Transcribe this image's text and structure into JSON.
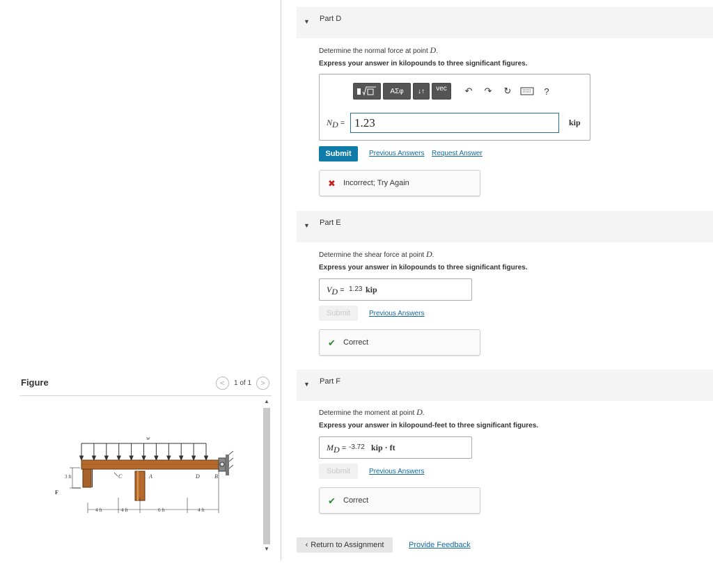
{
  "figure": {
    "title": "Figure",
    "pager": "1 of 1",
    "labels": {
      "w": "w",
      "c": "C",
      "a": "A",
      "d": "D",
      "b": "B",
      "f": "F",
      "h": "3 ft",
      "d1": "4 ft",
      "d2": "4 ft",
      "d3": "6 ft",
      "d4": "4 ft"
    }
  },
  "toolbar": {
    "greek": "ΑΣφ",
    "arrows": "↓↑",
    "vec": "vec",
    "help": "?"
  },
  "parts": [
    {
      "title": "Part D",
      "question_prefix": "Determine the normal force at point ",
      "question_var": "D",
      "instruction": "Express your answer in kilopounds to three significant figures.",
      "label_sym": "N",
      "label_sub": "D",
      "label_eq": "=",
      "input_value": "1.23",
      "unit": "kip",
      "submit": "Submit",
      "previous_answers": "Previous Answers",
      "request_answer": "Request Answer",
      "feedback": "Incorrect; Try Again"
    },
    {
      "title": "Part E",
      "question_prefix": "Determine the shear force at point ",
      "question_var": "D",
      "instruction": "Express your answer in kilopounds to three significant figures.",
      "label_sym": "V",
      "label_sub": "D",
      "label_eq": "=",
      "value": "1.23",
      "unit": "kip",
      "submit": "Submit",
      "previous_answers": "Previous Answers",
      "feedback": "Correct"
    },
    {
      "title": "Part F",
      "question_prefix": "Determine the moment at point ",
      "question_var": "D",
      "instruction": "Express your answer in kilopound-feet to three significant figures.",
      "label_sym": "M",
      "label_sub": "D",
      "label_eq": "=",
      "value": "-3.72",
      "unit": "kip · ft",
      "submit": "Submit",
      "previous_answers": "Previous Answers",
      "feedback": "Correct"
    }
  ],
  "footer": {
    "return": "Return to Assignment",
    "feedback": "Provide Feedback"
  },
  "colors": {
    "accent": "#0f7ba8",
    "error": "#cc1f1f",
    "success": "#2b8a2b"
  }
}
